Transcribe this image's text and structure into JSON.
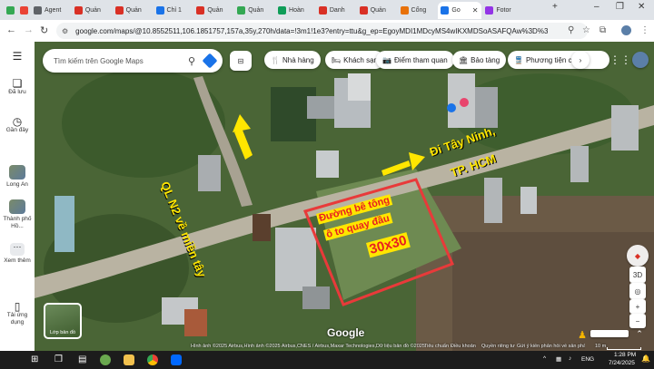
{
  "tabs": [
    {
      "label": "",
      "color": "#34a853"
    },
    {
      "label": "",
      "color": "#ea4335"
    },
    {
      "label": "Agent",
      "color": "#5f6368"
    },
    {
      "label": "Quản",
      "color": "#d93025"
    },
    {
      "label": "Quản",
      "color": "#d93025"
    },
    {
      "label": "Chỉ 1",
      "color": "#1a73e8"
    },
    {
      "label": "Quản",
      "color": "#d93025"
    },
    {
      "label": "Quản",
      "color": "#34a853"
    },
    {
      "label": "Hoàn",
      "color": "#0f9d58"
    },
    {
      "label": "Danh",
      "color": "#d93025"
    },
    {
      "label": "Quản",
      "color": "#d93025"
    },
    {
      "label": "Cổng",
      "color": "#e8710a"
    },
    {
      "label": "Go",
      "color": "#1a73e8"
    },
    {
      "label": "Fotor",
      "color": "#9334e6"
    }
  ],
  "address": {
    "url": "google.com/maps/@10.8552511,106.1851757,157a,35y,270h/data=!3m1!1e3?entry=ttu&g_ep=EgoyMDI1MDcyMS4wIKXMDSoASAFQAw%3D%3D"
  },
  "rail": {
    "menu_label": "",
    "saved": "Đã lưu",
    "recent": "Gần đây",
    "place1": "Long An",
    "place2": "Thành phố Hồ...",
    "more": "Xem thêm",
    "download": "Tải ứng dụng"
  },
  "map": {
    "search_placeholder": "Tìm kiếm trên Google Maps",
    "chips": [
      "Nhà hàng",
      "Khách sạn",
      "Điểm tham quan",
      "Bảo tàng",
      "Phương tiện công"
    ],
    "labels": {
      "ql": "QL N2 về miền tây",
      "tayninh": "Đi Tây Ninh,",
      "hcm": "TP. HCM",
      "road": "Đường bê tông",
      "uturn": "ô to quay đầu",
      "size": "30x30"
    },
    "layer_label": "Lớp bản đồ",
    "google": "Google",
    "attribution": "Hình ảnh ©2025 Airbus,Hình ảnh ©2025 Airbus,CNES / Airbus,Maxar Technologies,Dữ liệu bản đồ ©2025",
    "links": [
      "Tiêu chuẩn",
      "Điều khoản",
      "Quyền riêng tư",
      "Gửi ý kiến phản hồi về sản phẩm"
    ],
    "scale": "10 m",
    "ctl_3d": "3D"
  },
  "taskbar": {
    "lang": "ENG",
    "time": "1:28 PM",
    "date": "7/24/2025"
  }
}
